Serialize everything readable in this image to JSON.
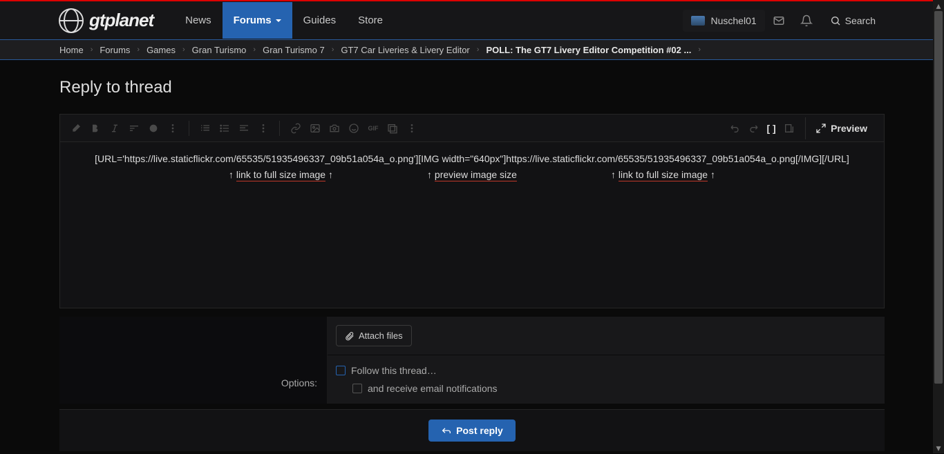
{
  "site": {
    "logo_text": "gtplanet"
  },
  "nav": {
    "news": "News",
    "forums": "Forums",
    "guides": "Guides",
    "store": "Store"
  },
  "user": {
    "name": "Nuschel01",
    "search_label": "Search"
  },
  "breadcrumb": {
    "home": "Home",
    "forums": "Forums",
    "games": "Games",
    "gran_turismo": "Gran Turismo",
    "gt7": "Gran Turismo 7",
    "liveries": "GT7 Car Liveries & Livery Editor",
    "poll": "POLL: The GT7 Livery Editor Competition #02 ..."
  },
  "page": {
    "title": "Reply to thread"
  },
  "toolbar": {
    "preview": "Preview"
  },
  "editor": {
    "line1": "[URL='https://live.staticflickr.com/65535/51935496337_09b51a054a_o.png'][IMG width=\"640px\"]https://live.staticflickr.com/65535/51935496337_09b51a054a_o.png[/IMG][/URL]",
    "hint_left_prefix": "↑ ",
    "hint_left_text": "link to full size image",
    "hint_left_suffix": " ↑",
    "hint_mid_prefix": "↑ ",
    "hint_mid_text": "preview image size",
    "hint_right_prefix": "↑ ",
    "hint_right_text": "link to full size image",
    "hint_right_suffix": " ↑"
  },
  "options": {
    "label": "Options:",
    "attach": "Attach files",
    "follow": "Follow this thread…",
    "email": "and receive email notifications"
  },
  "footer": {
    "post": "Post reply"
  }
}
